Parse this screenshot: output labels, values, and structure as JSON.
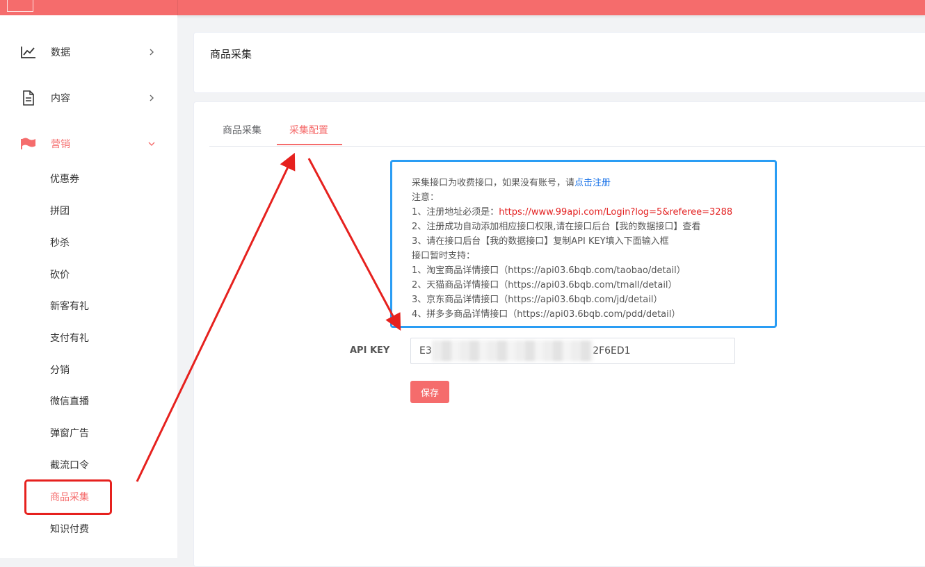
{
  "colors": {
    "accent": "#f56c6c",
    "highlight_blue": "#2a9df4",
    "annotation_red": "#e6211e"
  },
  "sidebar": {
    "menus": [
      {
        "label": "数据",
        "icon": "line-chart-icon",
        "expanded": false
      },
      {
        "label": "内容",
        "icon": "document-icon",
        "expanded": false
      },
      {
        "label": "营销",
        "icon": "flag-icon",
        "expanded": true
      }
    ],
    "sub_items": [
      "优惠券",
      "拼团",
      "秒杀",
      "砍价",
      "新客有礼",
      "支付有礼",
      "分销",
      "微信直播",
      "弹窗广告",
      "截流口令",
      "商品采集",
      "知识付费"
    ],
    "active_sub": "商品采集"
  },
  "header": {
    "title": "商品采集"
  },
  "tabs": [
    {
      "label": "商品采集",
      "active": false
    },
    {
      "label": "采集配置",
      "active": true
    }
  ],
  "notice": {
    "line1_prefix": "采集接口为收费接口，如果没有账号，请",
    "line1_link": "点击注册",
    "note_title": "注意：",
    "note1_prefix": "1、注册地址必须是：",
    "note1_url": "https://www.99api.com/Login?log=5&referee=3288",
    "note2": "2、注册成功自动添加相应接口权限,请在接口后台【我的数据接口】查看",
    "note3": "3、请在接口后台【我的数据接口】复制API KEY填入下面输入框",
    "support_title": "接口暂时支持：",
    "support1": "1、淘宝商品详情接口（https://api03.6bqb.com/taobao/detail）",
    "support2": "2、天猫商品详情接口（https://api03.6bqb.com/tmall/detail）",
    "support3": "3、京东商品详情接口（https://api03.6bqb.com/jd/detail）",
    "support4": "4、拼多多商品详情接口（https://api03.6bqb.com/pdd/detail）"
  },
  "form": {
    "api_key_label": "API KEY",
    "api_key_value": "E3                                                    2F6ED1",
    "save_label": "保存"
  }
}
